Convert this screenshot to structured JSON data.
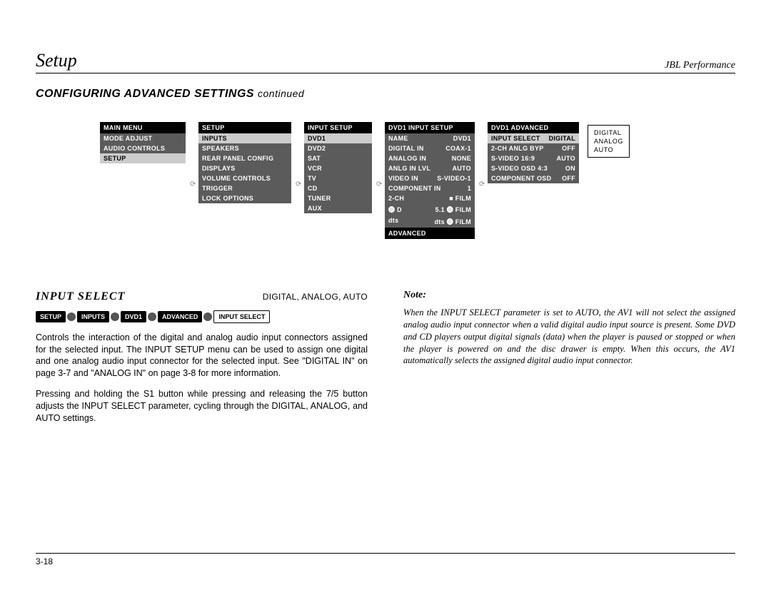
{
  "header": {
    "left": "Setup",
    "right": "JBL Performance"
  },
  "subheading": {
    "main": "CONFIGURING ADVANCED SETTINGS",
    "cont": "continued"
  },
  "menus": {
    "m1": {
      "title": "MAIN MENU",
      "items": [
        "MODE ADJUST",
        "AUDIO CONTROLS",
        "SETUP"
      ],
      "hl": 2
    },
    "m2": {
      "title": "SETUP",
      "items": [
        "INPUTS",
        "SPEAKERS",
        "REAR PANEL CONFIG",
        "DISPLAYS",
        "VOLUME CONTROLS",
        "TRIGGER",
        "LOCK OPTIONS"
      ],
      "hl": 0
    },
    "m3": {
      "title": "INPUT SETUP",
      "items": [
        "DVD1",
        "DVD2",
        "SAT",
        "VCR",
        "TV",
        "CD",
        "TUNER",
        "AUX"
      ],
      "hl": 0
    },
    "m4": {
      "title": "DVD1 INPUT SETUP",
      "rows": [
        {
          "k": "NAME",
          "v": "DVD1"
        },
        {
          "k": "DIGITAL IN",
          "v": "COAX-1"
        },
        {
          "k": "ANALOG IN",
          "v": "NONE"
        },
        {
          "k": "ANLG IN LVL",
          "v": "AUTO"
        },
        {
          "k": "VIDEO IN",
          "v": "S-VIDEO-1"
        },
        {
          "k": "COMPONENT IN",
          "v": "1"
        },
        {
          "k": "2-CH",
          "v": "■ FILM"
        },
        {
          "k": "🅓 D",
          "v": "5.1 🅓 FILM"
        },
        {
          "k": "dts",
          "v": "dts 🅓 FILM"
        }
      ],
      "bottom": "ADVANCED"
    },
    "m5": {
      "title": "DVD1 ADVANCED",
      "rows": [
        {
          "k": "INPUT SELECT",
          "v": "DIGITAL",
          "hl": true
        },
        {
          "k": "2-CH ANLG BYP",
          "v": "OFF"
        },
        {
          "k": "S-VIDEO 16:9",
          "v": "AUTO"
        },
        {
          "k": "S-VIDEO OSD 4:3",
          "v": "ON"
        },
        {
          "k": "COMPONENT OSD",
          "v": "OFF"
        }
      ]
    },
    "popup": [
      "DIGITAL",
      "ANALOG",
      "AUTO"
    ]
  },
  "section": {
    "title": "INPUT SELECT",
    "options": "DIGITAL, ANALOG, AUTO",
    "crumbs": [
      "SETUP",
      "INPUTS",
      "DVD1",
      "ADVANCED",
      "INPUT SELECT"
    ],
    "p1": "Controls the interaction of the digital and analog audio input connectors assigned for the selected input. The INPUT SETUP menu can be used to assign one digital and one analog audio input connector for the selected input. See \"DIGITAL IN\" on page 3-7 and \"ANALOG IN\" on page 3-8 for more information.",
    "p2": "Pressing and holding the S1 button while pressing and releasing the 7/5 button adjusts the INPUT SELECT parameter, cycling through the DIGITAL, ANALOG, and AUTO settings."
  },
  "note": {
    "head": "Note:",
    "body": "When the INPUT SELECT parameter is set to AUTO, the AV1 will not select the assigned analog audio input connector when a valid digital audio input source is present. Some DVD and CD players output digital signals (data) when the player is paused or stopped or when the player is powered on and the disc drawer is empty. When this occurs, the AV1 automatically selects the assigned digital audio input connector."
  },
  "pageno": "3-18"
}
